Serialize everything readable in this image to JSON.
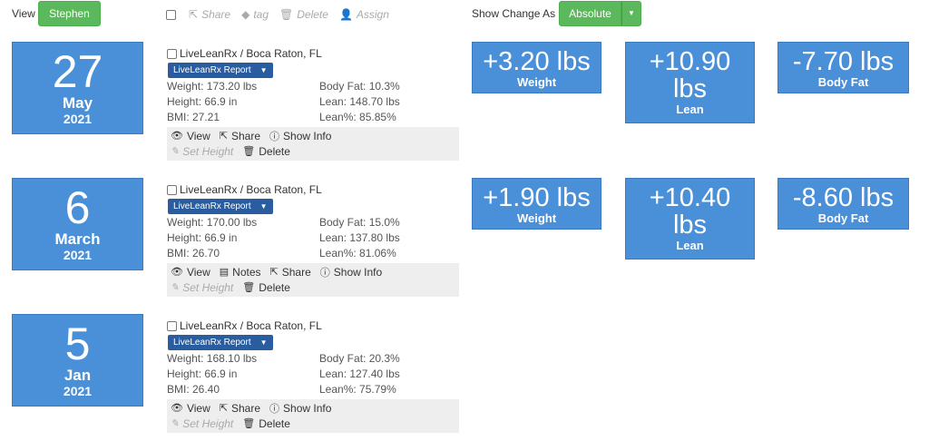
{
  "top": {
    "view_label": "View",
    "view_user": "Stephen",
    "toolbar": {
      "share": "Share",
      "tag": "tag",
      "delete": "Delete",
      "assign": "Assign"
    },
    "show_change_label": "Show Change As",
    "show_change_value": "Absolute"
  },
  "entries": [
    {
      "day": "27",
      "month": "May",
      "year": "2021",
      "location": "LiveLeanRx / Boca Raton, FL",
      "report": "LiveLeanRx Report",
      "weight": "Weight: 173.20 lbs",
      "height": "Height: 66.9 in",
      "bmi": "BMI: 27.21",
      "bodyfat": "Body Fat: 10.3%",
      "lean": "Lean: 148.70 lbs",
      "leanpct": "Lean%: 85.85%",
      "actions": [
        "View",
        "Share",
        "Show Info"
      ],
      "set_height": "Set Height",
      "delete": "Delete"
    },
    {
      "day": "6",
      "month": "March",
      "year": "2021",
      "location": "LiveLeanRx / Boca Raton, FL",
      "report": "LiveLeanRx Report",
      "weight": "Weight: 170.00 lbs",
      "height": "Height: 66.9 in",
      "bmi": "BMI: 26.70",
      "bodyfat": "Body Fat: 15.0%",
      "lean": "Lean: 137.80 lbs",
      "leanpct": "Lean%: 81.06%",
      "actions": [
        "View",
        "Notes",
        "Share",
        "Show Info"
      ],
      "set_height": "Set Height",
      "delete": "Delete"
    },
    {
      "day": "5",
      "month": "Jan",
      "year": "2021",
      "location": "LiveLeanRx / Boca Raton, FL",
      "report": "LiveLeanRx Report",
      "weight": "Weight: 168.10 lbs",
      "height": "Height: 66.9 in",
      "bmi": "BMI: 26.40",
      "bodyfat": "Body Fat: 20.3%",
      "lean": "Lean: 127.40 lbs",
      "leanpct": "Lean%: 75.79%",
      "actions": [
        "View",
        "Share",
        "Show Info"
      ],
      "set_height": "Set Height",
      "delete": "Delete"
    }
  ],
  "changes": [
    {
      "weight": {
        "value": "+3.20 lbs",
        "label": "Weight"
      },
      "lean": {
        "value_line1": "+10.90",
        "value_line2": "lbs",
        "label": "Lean"
      },
      "bodyfat": {
        "value": "-7.70 lbs",
        "label": "Body Fat"
      }
    },
    {
      "weight": {
        "value": "+1.90 lbs",
        "label": "Weight"
      },
      "lean": {
        "value_line1": "+10.40",
        "value_line2": "lbs",
        "label": "Lean"
      },
      "bodyfat": {
        "value": "-8.60 lbs",
        "label": "Body Fat"
      }
    }
  ],
  "colors": {
    "tile_blue": "#4a90d9",
    "report_blue": "#2a5d9f",
    "button_green": "#5cb85c"
  }
}
